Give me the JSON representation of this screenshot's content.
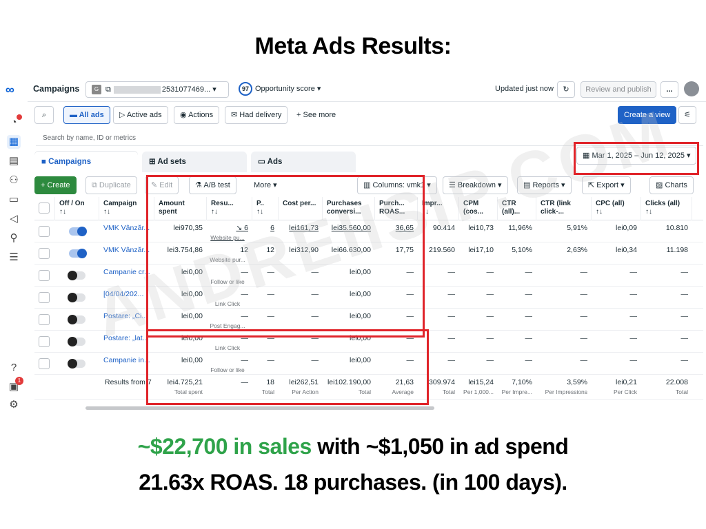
{
  "headline": "Meta Ads Results:",
  "footer": {
    "line1_green": "~$22,700 in sales",
    "line1_rest": " with ~$1,050 in ad spend",
    "line2": "21.63x ROAS. 18 purchases. (in 100 days)."
  },
  "watermark": "ANDREIISIP.COM",
  "topbar": {
    "title": "Campaigns",
    "account_badge": "G",
    "account_id": "2531077469...",
    "opportunity_score": "97",
    "opportunity_label": "Opportunity score",
    "updated": "Updated just now",
    "review_publish": "Review and publish",
    "more": "..."
  },
  "filters": {
    "all_ads": "All ads",
    "active_ads": "Active ads",
    "actions": "Actions",
    "had_delivery": "Had delivery",
    "see_more": "See more",
    "create_view": "Create a view"
  },
  "search_placeholder": "Search by name, ID or metrics",
  "tabs": {
    "campaigns": "Campaigns",
    "ad_sets": "Ad sets",
    "ads": "Ads"
  },
  "date_range": "Mar 1, 2025 – Jun 12, 2025",
  "toolbar": {
    "create": "Create",
    "duplicate": "Duplicate",
    "edit": "Edit",
    "ab_test": "A/B test",
    "more": "More",
    "columns": "Columns: vmk1",
    "breakdown": "Breakdown",
    "reports": "Reports",
    "export": "Export",
    "charts": "Charts"
  },
  "headers": {
    "offon": "Off / On",
    "campaign": "Campaign",
    "amount": "Amount spent",
    "results": "Resu...",
    "p": "P..",
    "cost": "Cost per...",
    "purch_conv": "Purchases conversi...",
    "roas": "Purch... ROAS...",
    "impr": "Impr...",
    "cpm": "CPM (cos...",
    "ctr": "CTR (all)...",
    "ctr_link": "CTR (link click-...",
    "cpc": "CPC (all)",
    "clicks": "Clicks (all)",
    "sort": "↑↓"
  },
  "rows": [
    {
      "on": true,
      "campaign": "VMK Vânzăr...",
      "amount": "lei970,35",
      "results": "↘ 6",
      "results_sub": "Website pu...",
      "p": "6",
      "cost": "lei161,73",
      "purch": "lei35.560,00",
      "roas": "36,65",
      "impr": "90.414",
      "cpm": "lei10,73",
      "ctr": "11,96%",
      "ctr_link": "5,91%",
      "cpc": "lei0,09",
      "clicks": "10.810"
    },
    {
      "on": true,
      "campaign": "VMK Vânzăr...",
      "amount": "lei3.754,86",
      "results": "12",
      "results_sub": "Website pur...",
      "p": "12",
      "cost": "lei312,90",
      "purch": "lei66.630,00",
      "roas": "17,75",
      "impr": "219.560",
      "cpm": "lei17,10",
      "ctr": "5,10%",
      "ctr_link": "2,63%",
      "cpc": "lei0,34",
      "clicks": "11.198"
    },
    {
      "on": false,
      "campaign": "Campanie cr...",
      "amount": "lei0,00",
      "results": "—",
      "results_sub": "Follow or like",
      "p": "—",
      "cost": "—",
      "purch": "lei0,00",
      "roas": "—",
      "impr": "—",
      "cpm": "—",
      "ctr": "—",
      "ctr_link": "—",
      "cpc": "—",
      "clicks": "—"
    },
    {
      "on": false,
      "campaign": "[04/04/202...",
      "amount": "lei0,00",
      "results": "—",
      "results_sub": "Link Click",
      "p": "—",
      "cost": "—",
      "purch": "lei0,00",
      "roas": "—",
      "impr": "—",
      "cpm": "—",
      "ctr": "—",
      "ctr_link": "—",
      "cpc": "—",
      "clicks": "—"
    },
    {
      "on": false,
      "campaign": "Postare: „Ci...",
      "amount": "lei0,00",
      "results": "—",
      "results_sub": "Post Engag...",
      "p": "—",
      "cost": "—",
      "purch": "lei0,00",
      "roas": "—",
      "impr": "—",
      "cpm": "—",
      "ctr": "—",
      "ctr_link": "—",
      "cpc": "—",
      "clicks": "—"
    },
    {
      "on": false,
      "campaign": "Postare: „lat...",
      "amount": "lei0,00",
      "results": "—",
      "results_sub": "Link Click",
      "p": "—",
      "cost": "—",
      "purch": "lei0,00",
      "roas": "—",
      "impr": "—",
      "cpm": "—",
      "ctr": "—",
      "ctr_link": "—",
      "cpc": "—",
      "clicks": "—"
    },
    {
      "on": false,
      "campaign": "Campanie in...",
      "amount": "lei0,00",
      "results": "—",
      "results_sub": "Follow or like",
      "p": "—",
      "cost": "—",
      "purch": "lei0,00",
      "roas": "—",
      "impr": "—",
      "cpm": "—",
      "ctr": "—",
      "ctr_link": "—",
      "cpc": "—",
      "clicks": "—"
    }
  ],
  "totals": {
    "label": "Results from 7",
    "amount": "lei4.725,21",
    "amount_sub": "Total spent",
    "results": "—",
    "p": "18",
    "p_sub": "Total",
    "cost": "lei262,51",
    "cost_sub": "Per Action",
    "purch": "lei102.190,00",
    "purch_sub": "Total",
    "roas": "21,63",
    "roas_sub": "Average",
    "impr": "309.974",
    "impr_sub": "Total",
    "cpm": "lei15,24",
    "cpm_sub": "Per 1,000...",
    "ctr": "7,10%",
    "ctr_sub": "Per Impre...",
    "ctr_link": "3,59%",
    "ctr_link_sub": "Per Impressions",
    "cpc": "lei0,21",
    "cpc_sub": "Per Click",
    "clicks": "22.008",
    "clicks_sub": "Total"
  },
  "notifications_count": "1",
  "help": "?",
  "colors": {
    "accent": "#1f62c6",
    "highlight": "#e0242a",
    "green": "#2fa34a"
  }
}
